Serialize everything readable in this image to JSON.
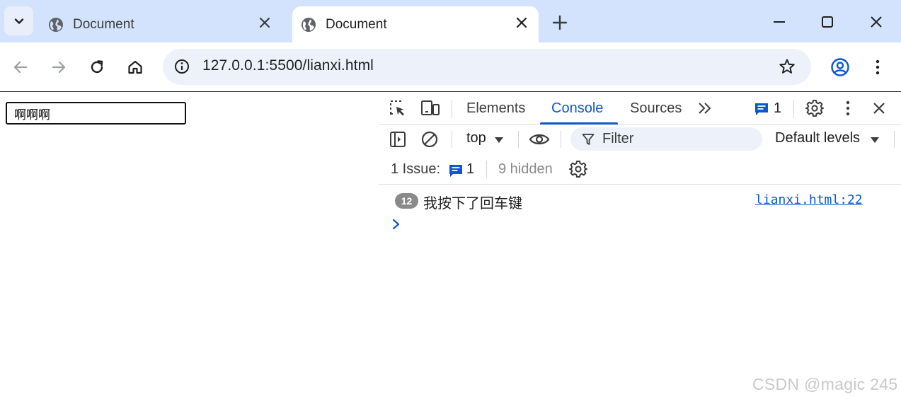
{
  "browser": {
    "tabs": [
      {
        "title": "Document",
        "active": false
      },
      {
        "title": "Document",
        "active": true
      }
    ],
    "address": "127.0.0.1:5500/lianxi.html"
  },
  "page": {
    "input_value": "啊啊啊"
  },
  "devtools": {
    "tabs": [
      "Elements",
      "Console",
      "Sources"
    ],
    "active_tab": "Console",
    "message_count": "1",
    "context": "top",
    "filter_placeholder": "Filter",
    "levels": "Default levels",
    "issues_label": "1 Issue:",
    "issues_count": "1",
    "hidden_label": "9 hidden",
    "log": {
      "repeat_count": "12",
      "message": "我按下了回车键",
      "source": "lianxi.html:22"
    }
  },
  "watermark": "CSDN @magic 245",
  "colors": {
    "tabstrip": "#d3e3fd",
    "accent": "#0b57d0",
    "omnibox": "#edf2fa"
  }
}
